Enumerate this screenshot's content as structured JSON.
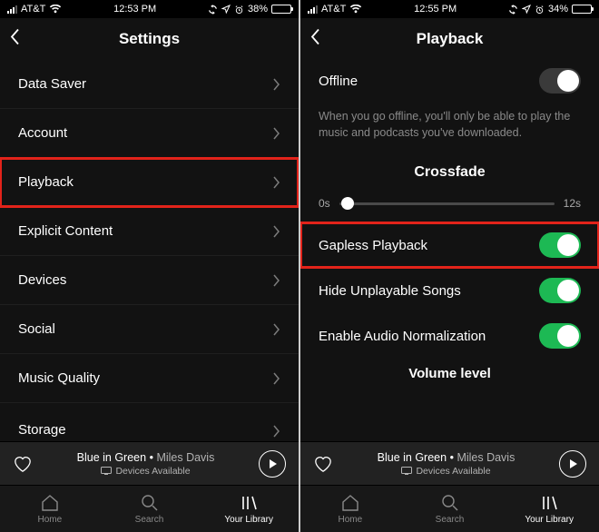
{
  "left": {
    "status": {
      "carrier": "AT&T",
      "time": "12:53 PM",
      "battery_pct": "38%",
      "battery_fill": 38
    },
    "header": {
      "title": "Settings"
    },
    "rows": [
      {
        "label": "Data Saver"
      },
      {
        "label": "Account"
      },
      {
        "label": "Playback",
        "highlighted": true
      },
      {
        "label": "Explicit Content"
      },
      {
        "label": "Devices"
      },
      {
        "label": "Social"
      },
      {
        "label": "Music Quality"
      },
      {
        "label": "Storage"
      }
    ]
  },
  "right": {
    "status": {
      "carrier": "AT&T",
      "time": "12:55 PM",
      "battery_pct": "34%",
      "battery_fill": 34
    },
    "header": {
      "title": "Playback"
    },
    "offline": {
      "label": "Offline",
      "on": false,
      "desc": "When you go offline, you'll only be able to play the music and podcasts you've downloaded."
    },
    "crossfade": {
      "title": "Crossfade",
      "min": "0s",
      "max": "12s",
      "value_pct": 4
    },
    "toggles": [
      {
        "label": "Gapless Playback",
        "on": true,
        "highlighted": true
      },
      {
        "label": "Hide Unplayable Songs",
        "on": true
      },
      {
        "label": "Enable Audio Normalization",
        "on": true
      }
    ],
    "cut_title": "Volume level"
  },
  "now_playing": {
    "track": "Blue in Green",
    "separator": "•",
    "artist": "Miles Davis",
    "devices": "Devices Available"
  },
  "tabs": {
    "home": "Home",
    "search": "Search",
    "library": "Your Library"
  },
  "icons": {
    "wifi": "wifi",
    "location": "loc",
    "alarm": "alarm",
    "heart": "heart",
    "cast": "cast",
    "home": "home",
    "search": "search",
    "library": "library"
  }
}
